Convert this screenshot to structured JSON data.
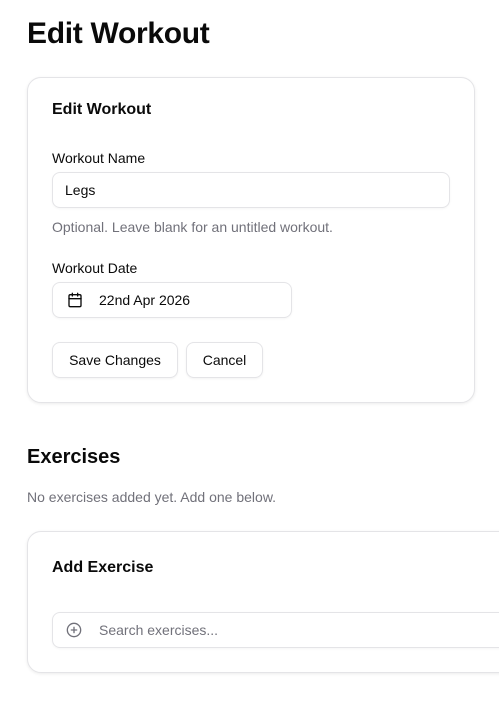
{
  "page": {
    "title": "Edit Workout"
  },
  "edit_card": {
    "title": "Edit Workout",
    "name_label": "Workout Name",
    "name_value": "Legs",
    "name_hint": "Optional. Leave blank for an untitled workout.",
    "date_label": "Workout Date",
    "date_value": "22nd Apr 2026",
    "save_label": "Save Changes",
    "cancel_label": "Cancel"
  },
  "exercises": {
    "title": "Exercises",
    "empty_text": "No exercises added yet. Add one below."
  },
  "add_card": {
    "title": "Add Exercise",
    "search_placeholder": "Search exercises..."
  },
  "icons": {
    "date": "calendar-icon",
    "search": "plus-circle-icon"
  },
  "colors": {
    "text": "#0a0a0a",
    "muted": "#71717a",
    "border": "#e4e4e7"
  }
}
